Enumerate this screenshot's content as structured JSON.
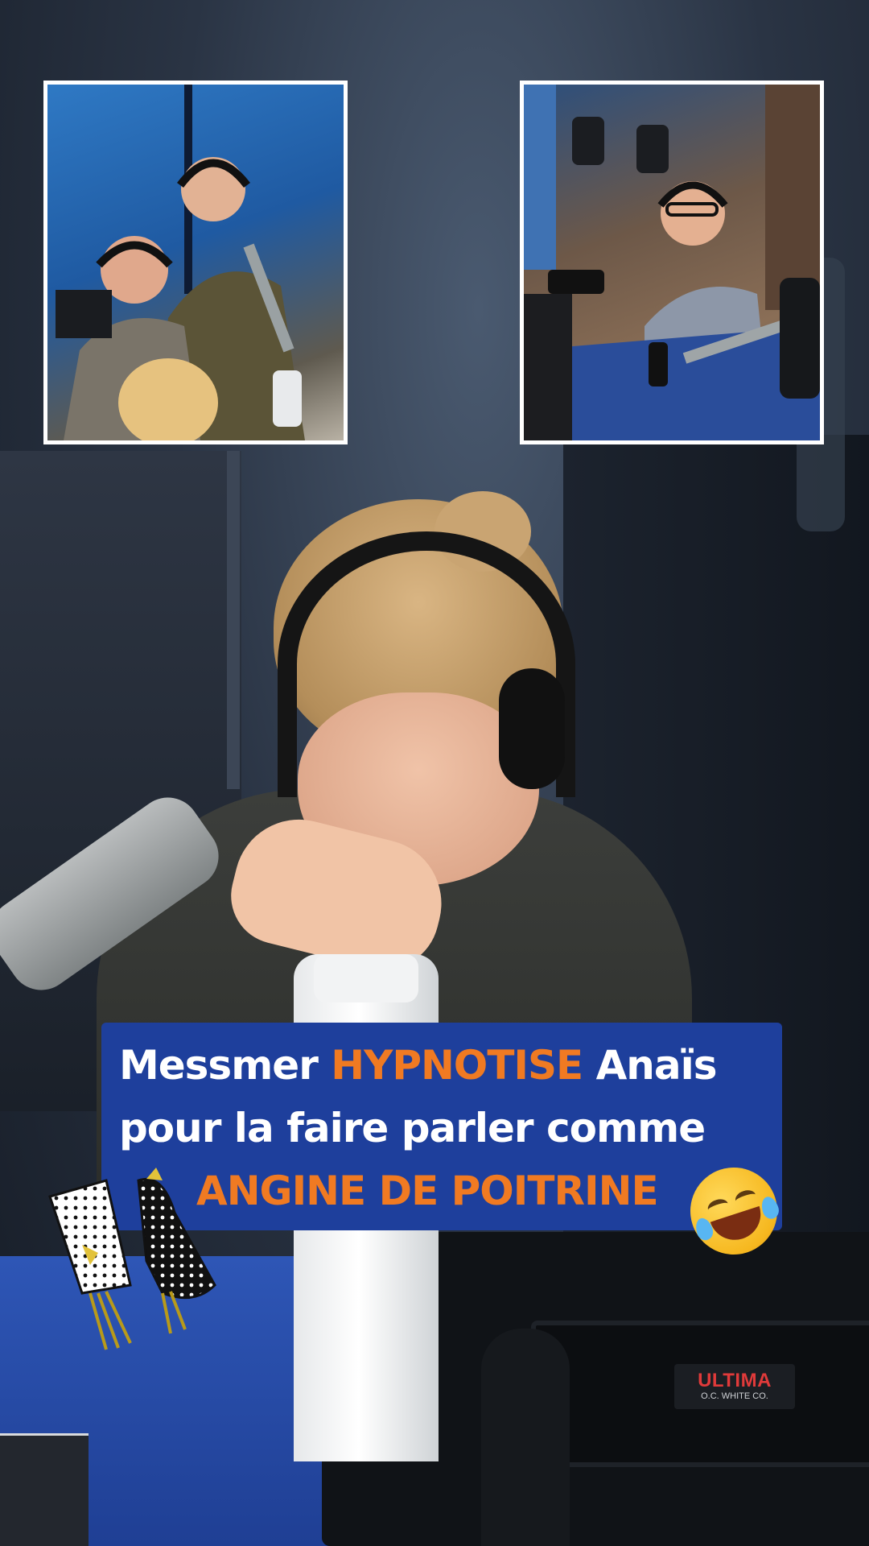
{
  "caption": {
    "line1_part1": "Messmer ",
    "line1_highlight": "HYPNOTISE",
    "line1_part2": " Anaïs",
    "line2": "pour la faire parler comme",
    "line3_highlight": "ANGINE DE POITRINE",
    "emoji": "rolling-on-floor-laughing-emoji"
  },
  "studio": {
    "monitor_brand": "ULTIMA",
    "monitor_brand_sub": "O.C. WHITE CO."
  },
  "colors": {
    "caption_background": "#1e3f9c",
    "caption_text": "#ffffff",
    "caption_highlight": "#f07a22",
    "thumbnail_border": "#ffffff",
    "desk_blue": "#2e56b6"
  },
  "thumbnails": {
    "left": "two-men-laughing-in-studio",
    "right": "man-with-glasses-smiling-at-desk"
  }
}
